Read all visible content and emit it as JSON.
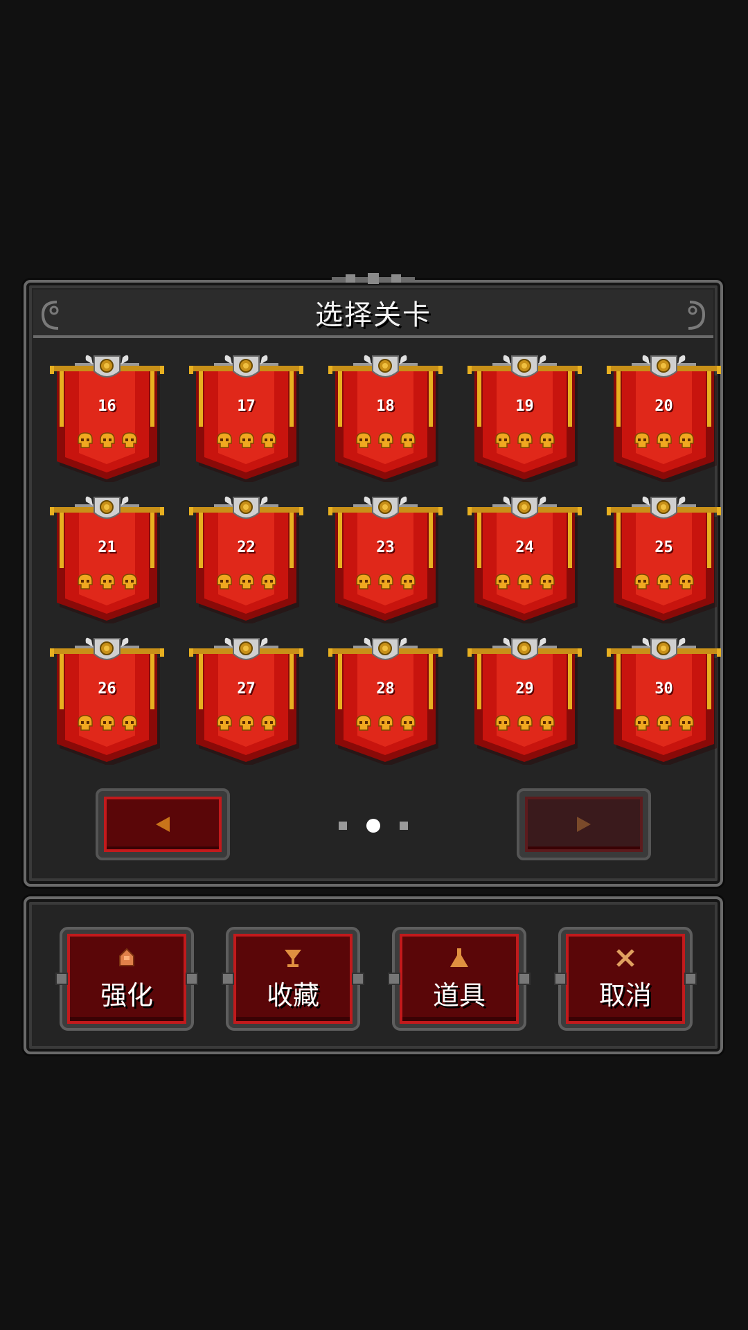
{
  "title": "选择关卡",
  "levels": [
    {
      "number": "16",
      "skulls": 3
    },
    {
      "number": "17",
      "skulls": 3
    },
    {
      "number": "18",
      "skulls": 3
    },
    {
      "number": "19",
      "skulls": 3
    },
    {
      "number": "20",
      "skulls": 3
    },
    {
      "number": "21",
      "skulls": 3
    },
    {
      "number": "22",
      "skulls": 3
    },
    {
      "number": "23",
      "skulls": 3
    },
    {
      "number": "24",
      "skulls": 3
    },
    {
      "number": "25",
      "skulls": 3
    },
    {
      "number": "26",
      "skulls": 3
    },
    {
      "number": "27",
      "skulls": 3
    },
    {
      "number": "28",
      "skulls": 3
    },
    {
      "number": "29",
      "skulls": 3
    },
    {
      "number": "30",
      "skulls": 3
    }
  ],
  "pager": {
    "total_pages": 3,
    "current_page": 2,
    "prev_enabled": true,
    "next_enabled": false
  },
  "actions": [
    {
      "label": "强化",
      "icon": "upgrade-icon"
    },
    {
      "label": "收藏",
      "icon": "trophy-cup-icon"
    },
    {
      "label": "道具",
      "icon": "potion-flask-icon"
    },
    {
      "label": "取消",
      "icon": "close-icon"
    }
  ],
  "colors": {
    "banner_red": "#c8140e",
    "banner_dark": "#8a0a08",
    "gold": "#e8a21a",
    "button_red": "#5a0608",
    "button_border": "#c21a1c"
  }
}
